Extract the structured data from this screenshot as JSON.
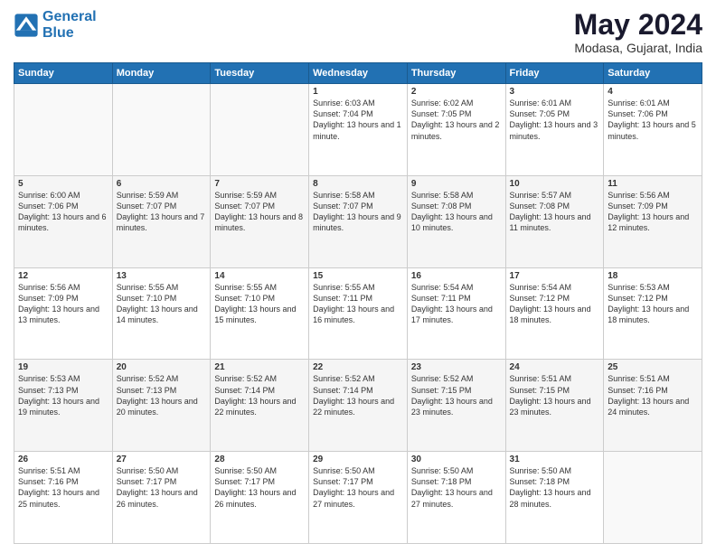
{
  "header": {
    "logo_line1": "General",
    "logo_line2": "Blue",
    "month": "May 2024",
    "location": "Modasa, Gujarat, India"
  },
  "weekdays": [
    "Sunday",
    "Monday",
    "Tuesday",
    "Wednesday",
    "Thursday",
    "Friday",
    "Saturday"
  ],
  "weeks": [
    [
      {
        "day": "",
        "sunrise": "",
        "sunset": "",
        "daylight": ""
      },
      {
        "day": "",
        "sunrise": "",
        "sunset": "",
        "daylight": ""
      },
      {
        "day": "",
        "sunrise": "",
        "sunset": "",
        "daylight": ""
      },
      {
        "day": "1",
        "sunrise": "Sunrise: 6:03 AM",
        "sunset": "Sunset: 7:04 PM",
        "daylight": "Daylight: 13 hours and 1 minute."
      },
      {
        "day": "2",
        "sunrise": "Sunrise: 6:02 AM",
        "sunset": "Sunset: 7:05 PM",
        "daylight": "Daylight: 13 hours and 2 minutes."
      },
      {
        "day": "3",
        "sunrise": "Sunrise: 6:01 AM",
        "sunset": "Sunset: 7:05 PM",
        "daylight": "Daylight: 13 hours and 3 minutes."
      },
      {
        "day": "4",
        "sunrise": "Sunrise: 6:01 AM",
        "sunset": "Sunset: 7:06 PM",
        "daylight": "Daylight: 13 hours and 5 minutes."
      }
    ],
    [
      {
        "day": "5",
        "sunrise": "Sunrise: 6:00 AM",
        "sunset": "Sunset: 7:06 PM",
        "daylight": "Daylight: 13 hours and 6 minutes."
      },
      {
        "day": "6",
        "sunrise": "Sunrise: 5:59 AM",
        "sunset": "Sunset: 7:07 PM",
        "daylight": "Daylight: 13 hours and 7 minutes."
      },
      {
        "day": "7",
        "sunrise": "Sunrise: 5:59 AM",
        "sunset": "Sunset: 7:07 PM",
        "daylight": "Daylight: 13 hours and 8 minutes."
      },
      {
        "day": "8",
        "sunrise": "Sunrise: 5:58 AM",
        "sunset": "Sunset: 7:07 PM",
        "daylight": "Daylight: 13 hours and 9 minutes."
      },
      {
        "day": "9",
        "sunrise": "Sunrise: 5:58 AM",
        "sunset": "Sunset: 7:08 PM",
        "daylight": "Daylight: 13 hours and 10 minutes."
      },
      {
        "day": "10",
        "sunrise": "Sunrise: 5:57 AM",
        "sunset": "Sunset: 7:08 PM",
        "daylight": "Daylight: 13 hours and 11 minutes."
      },
      {
        "day": "11",
        "sunrise": "Sunrise: 5:56 AM",
        "sunset": "Sunset: 7:09 PM",
        "daylight": "Daylight: 13 hours and 12 minutes."
      }
    ],
    [
      {
        "day": "12",
        "sunrise": "Sunrise: 5:56 AM",
        "sunset": "Sunset: 7:09 PM",
        "daylight": "Daylight: 13 hours and 13 minutes."
      },
      {
        "day": "13",
        "sunrise": "Sunrise: 5:55 AM",
        "sunset": "Sunset: 7:10 PM",
        "daylight": "Daylight: 13 hours and 14 minutes."
      },
      {
        "day": "14",
        "sunrise": "Sunrise: 5:55 AM",
        "sunset": "Sunset: 7:10 PM",
        "daylight": "Daylight: 13 hours and 15 minutes."
      },
      {
        "day": "15",
        "sunrise": "Sunrise: 5:55 AM",
        "sunset": "Sunset: 7:11 PM",
        "daylight": "Daylight: 13 hours and 16 minutes."
      },
      {
        "day": "16",
        "sunrise": "Sunrise: 5:54 AM",
        "sunset": "Sunset: 7:11 PM",
        "daylight": "Daylight: 13 hours and 17 minutes."
      },
      {
        "day": "17",
        "sunrise": "Sunrise: 5:54 AM",
        "sunset": "Sunset: 7:12 PM",
        "daylight": "Daylight: 13 hours and 18 minutes."
      },
      {
        "day": "18",
        "sunrise": "Sunrise: 5:53 AM",
        "sunset": "Sunset: 7:12 PM",
        "daylight": "Daylight: 13 hours and 18 minutes."
      }
    ],
    [
      {
        "day": "19",
        "sunrise": "Sunrise: 5:53 AM",
        "sunset": "Sunset: 7:13 PM",
        "daylight": "Daylight: 13 hours and 19 minutes."
      },
      {
        "day": "20",
        "sunrise": "Sunrise: 5:52 AM",
        "sunset": "Sunset: 7:13 PM",
        "daylight": "Daylight: 13 hours and 20 minutes."
      },
      {
        "day": "21",
        "sunrise": "Sunrise: 5:52 AM",
        "sunset": "Sunset: 7:14 PM",
        "daylight": "Daylight: 13 hours and 22 minutes."
      },
      {
        "day": "22",
        "sunrise": "Sunrise: 5:52 AM",
        "sunset": "Sunset: 7:14 PM",
        "daylight": "Daylight: 13 hours and 22 minutes."
      },
      {
        "day": "23",
        "sunrise": "Sunrise: 5:52 AM",
        "sunset": "Sunset: 7:15 PM",
        "daylight": "Daylight: 13 hours and 23 minutes."
      },
      {
        "day": "24",
        "sunrise": "Sunrise: 5:51 AM",
        "sunset": "Sunset: 7:15 PM",
        "daylight": "Daylight: 13 hours and 23 minutes."
      },
      {
        "day": "25",
        "sunrise": "Sunrise: 5:51 AM",
        "sunset": "Sunset: 7:16 PM",
        "daylight": "Daylight: 13 hours and 24 minutes."
      }
    ],
    [
      {
        "day": "26",
        "sunrise": "Sunrise: 5:51 AM",
        "sunset": "Sunset: 7:16 PM",
        "daylight": "Daylight: 13 hours and 25 minutes."
      },
      {
        "day": "27",
        "sunrise": "Sunrise: 5:50 AM",
        "sunset": "Sunset: 7:17 PM",
        "daylight": "Daylight: 13 hours and 26 minutes."
      },
      {
        "day": "28",
        "sunrise": "Sunrise: 5:50 AM",
        "sunset": "Sunset: 7:17 PM",
        "daylight": "Daylight: 13 hours and 26 minutes."
      },
      {
        "day": "29",
        "sunrise": "Sunrise: 5:50 AM",
        "sunset": "Sunset: 7:17 PM",
        "daylight": "Daylight: 13 hours and 27 minutes."
      },
      {
        "day": "30",
        "sunrise": "Sunrise: 5:50 AM",
        "sunset": "Sunset: 7:18 PM",
        "daylight": "Daylight: 13 hours and 27 minutes."
      },
      {
        "day": "31",
        "sunrise": "Sunrise: 5:50 AM",
        "sunset": "Sunset: 7:18 PM",
        "daylight": "Daylight: 13 hours and 28 minutes."
      },
      {
        "day": "",
        "sunrise": "",
        "sunset": "",
        "daylight": ""
      }
    ]
  ]
}
